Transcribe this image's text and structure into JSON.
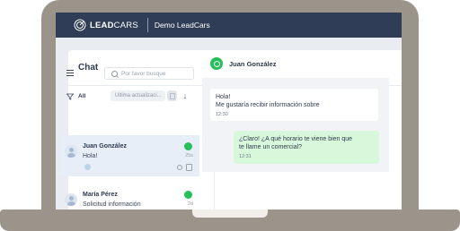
{
  "topbar": {
    "brand_bold": "LEAD",
    "brand_light": "CARS",
    "org_name": "Demo LeadCars"
  },
  "chat_panel": {
    "title": "Chat",
    "search_placeholder": "Por favor busque",
    "filter_label": "All",
    "sort_label": "Ultima actualizaci...",
    "sort_direction": "↓"
  },
  "conversations": [
    {
      "name": "Juan González",
      "preview": "Hola!",
      "time": "25s",
      "active": true
    },
    {
      "name": "María Pérez",
      "preview": "Solicitud información",
      "time": "2d",
      "active": false
    }
  ],
  "active_chat": {
    "contact_name": "Juan González",
    "messages": [
      {
        "direction": "in",
        "text_line1": "Hola!",
        "text_line2": "Me gustaría recibir información sobre",
        "time": "12:30"
      },
      {
        "direction": "out",
        "text_line1": "¿Claro! ¿A qué horario te viene bien que",
        "text_line2": "te llame un comercial?",
        "time": "12:31"
      }
    ]
  },
  "colors": {
    "topbar": "#2f3e56",
    "laptop_frame": "#9a948a",
    "whatsapp": "#25c05a",
    "outgoing_bubble": "#d8f8dc",
    "active_row": "#e8eef8"
  }
}
